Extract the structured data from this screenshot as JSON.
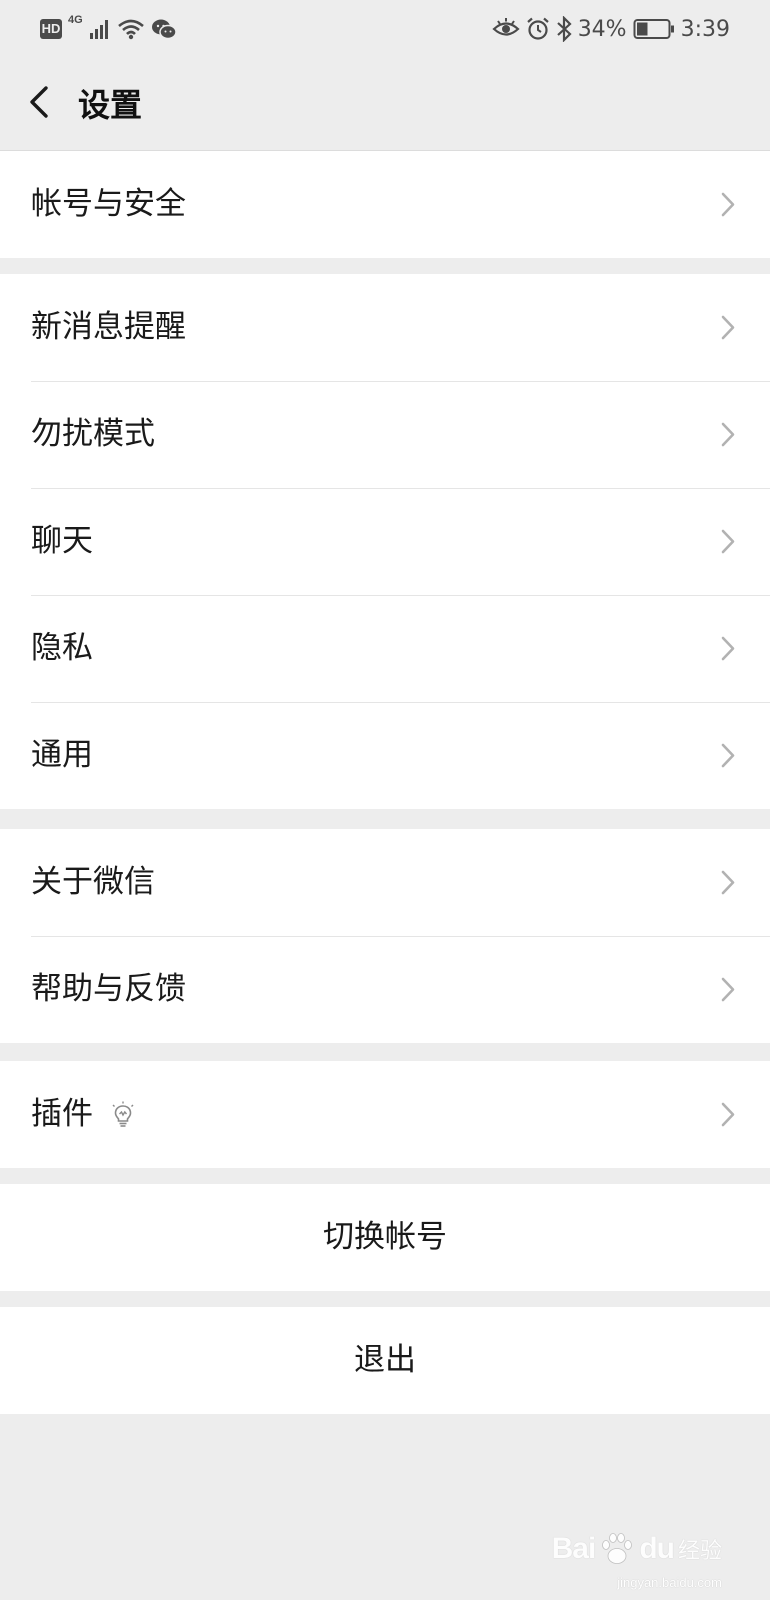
{
  "status_bar": {
    "hd_badge": "HD",
    "network_type": "4G",
    "battery_percent": "34%",
    "time": "3:39",
    "battery_level": 0.34,
    "icons": [
      "hd-icon",
      "signal-icon",
      "wifi-icon",
      "wechat-icon",
      "eye-icon",
      "alarm-icon",
      "bluetooth-icon",
      "battery-icon"
    ]
  },
  "nav": {
    "title": "设置",
    "back_icon": "chevron-left-icon"
  },
  "settings": {
    "account_security": "帐号与安全",
    "new_message_alerts": "新消息提醒",
    "do_not_disturb": "勿扰模式",
    "chat": "聊天",
    "privacy": "隐私",
    "general": "通用",
    "about_wechat": "关于微信",
    "help_feedback": "帮助与反馈",
    "plugins": "插件"
  },
  "actions": {
    "switch_account": "切换帐号",
    "log_out": "退出"
  },
  "watermark": {
    "brand": "Bai",
    "brand_suffix": "du",
    "brand_cn": "经验",
    "url": "jingyan.baidu.com"
  },
  "colors": {
    "page_background": "#ededed",
    "row_background": "#ffffff",
    "divider": "#e5e5e5",
    "text": "#1a1a1a",
    "chevron": "#b2b2b2"
  }
}
